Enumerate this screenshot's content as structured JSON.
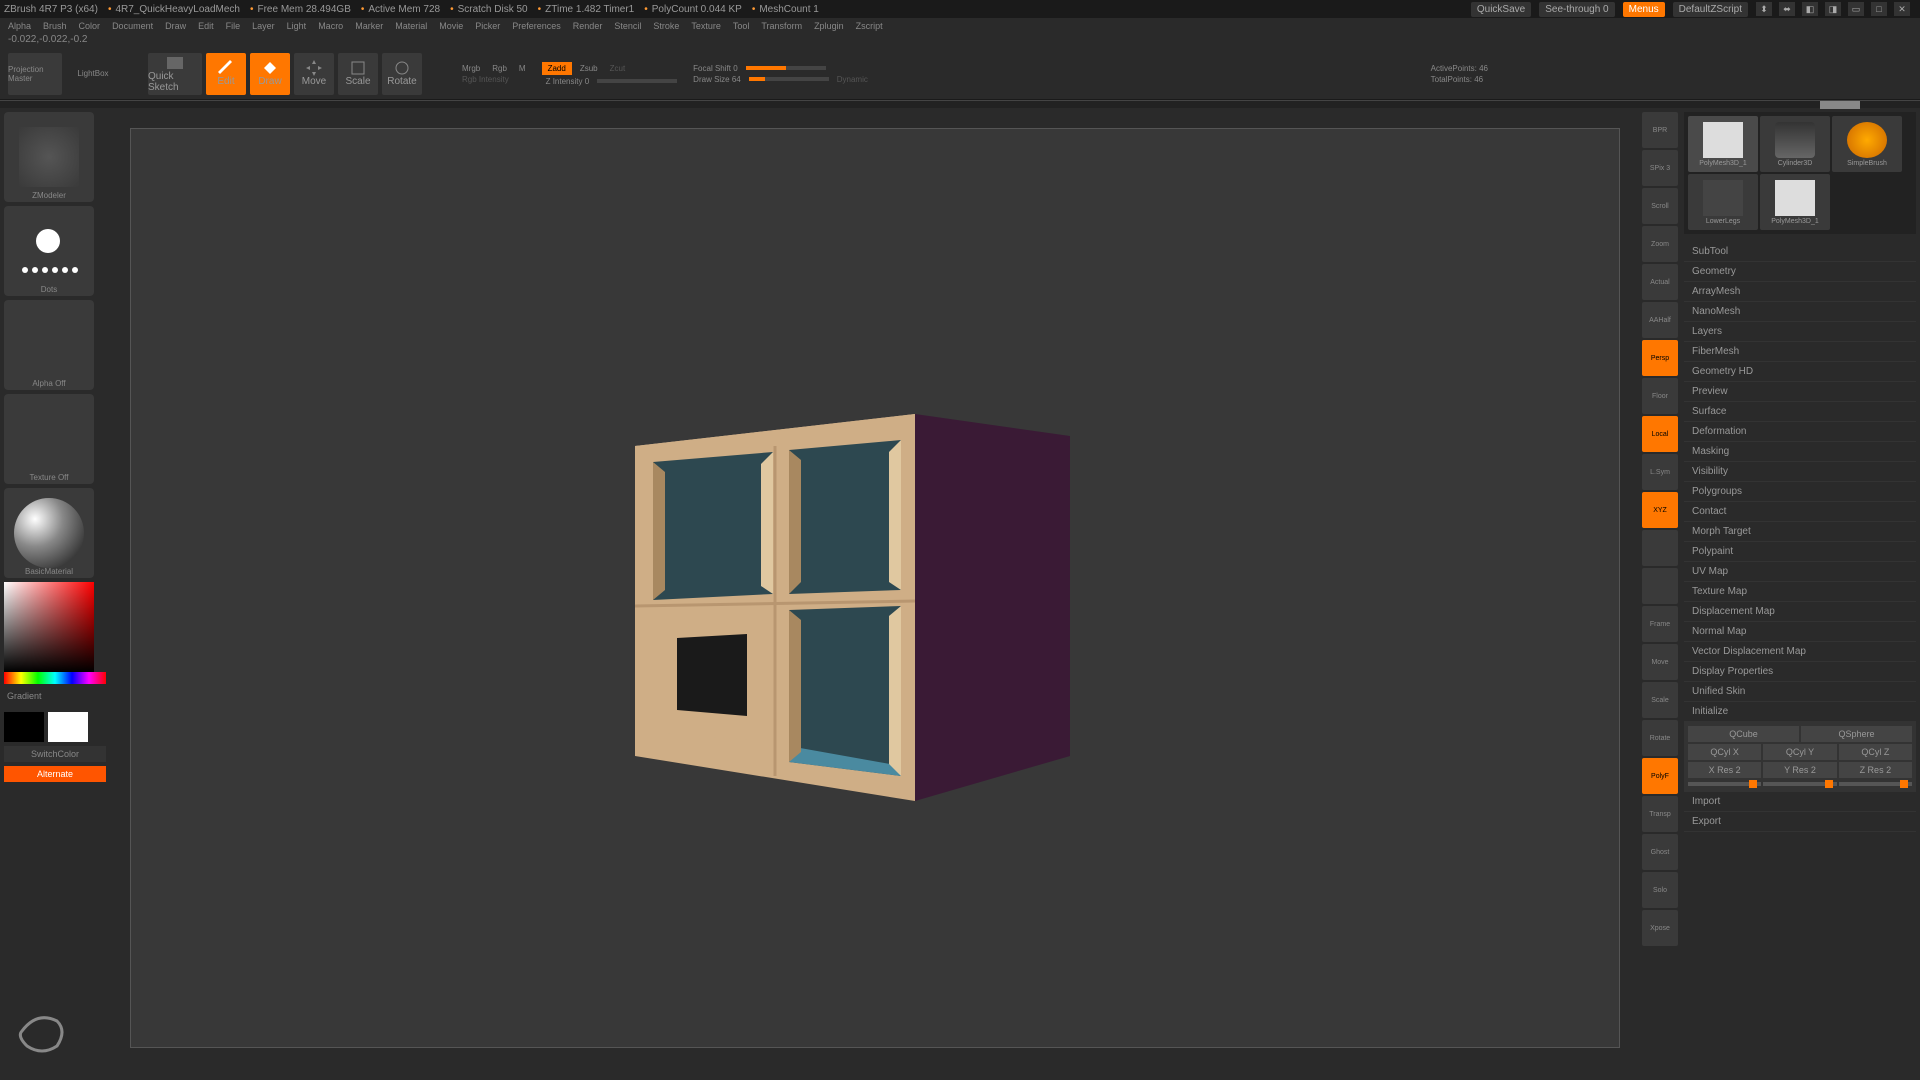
{
  "topbar": {
    "app": "ZBrush 4R7 P3 (x64)",
    "file": "4R7_QuickHeavyLoadMech",
    "stats": [
      "Free Mem 28.494GB",
      "Active Mem 728",
      "Scratch Disk 50",
      "ZTime 1.482 Timer1",
      "PolyCount 0.044 KP",
      "MeshCount 1"
    ],
    "quicksave": "QuickSave",
    "seethrough": "See-through  0",
    "menus": "Menus",
    "script": "DefaultZScript"
  },
  "menubar": [
    "Alpha",
    "Brush",
    "Color",
    "Document",
    "Draw",
    "Edit",
    "File",
    "Layer",
    "Light",
    "Macro",
    "Marker",
    "Material",
    "Movie",
    "Picker",
    "Preferences",
    "Render",
    "Stencil",
    "Stroke",
    "Texture",
    "Tool",
    "Transform",
    "Zplugin",
    "Zscript"
  ],
  "coords": "-0.022,-0.022,-0.2",
  "toolbar": {
    "projection": "Projection Master",
    "lightbox": "LightBox",
    "quicksketch": "Quick Sketch",
    "edit": "Edit",
    "draw": "Draw",
    "move": "Move",
    "scale": "Scale",
    "rotate": "Rotate",
    "mrgb": "Mrgb",
    "rgb": "Rgb",
    "m": "M",
    "rgbintensity": "Rgb Intensity",
    "zadd": "Zadd",
    "zsub": "Zsub",
    "zcut": "Zcut",
    "zintensity": "Z Intensity 0",
    "focalshift": "Focal Shift 0",
    "drawsize": "Draw Size 64",
    "dynamic": "Dynamic",
    "activepoints": "ActivePoints: 46",
    "totalpoints": "TotalPoints: 46"
  },
  "left": {
    "zmodeler": "ZModeler",
    "dots": "Dots",
    "alpha": "Alpha Off",
    "texture": "Texture Off",
    "material": "BasicMaterial",
    "gradient": "Gradient",
    "switchcolor": "SwitchColor",
    "alternate": "Alternate"
  },
  "rightToolbar": [
    "BPR",
    "SPix 3",
    "Scroll",
    "Zoom",
    "Actual",
    "AAHalf",
    "Persp",
    "Floor",
    "Local",
    "L.Sym",
    "XYZ",
    "",
    "",
    "Frame",
    "Move",
    "Scale",
    "Rotate",
    "PolyF",
    "Transp",
    "Ghost",
    "Solo",
    "Xpose"
  ],
  "rightToolbarActive": [
    6,
    8,
    10,
    17
  ],
  "toolThumbs": [
    {
      "label": "PolyMesh3D_1"
    },
    {
      "label": "Cylinder3D"
    },
    {
      "label": "SimpleBrush"
    },
    {
      "label": "LowerLegs"
    },
    {
      "label": "PolyMesh3D_1"
    }
  ],
  "panels": [
    "SubTool",
    "Geometry",
    "ArrayMesh",
    "NanoMesh",
    "Layers",
    "FiberMesh",
    "Geometry HD",
    "Preview",
    "Surface",
    "Deformation",
    "Masking",
    "Visibility",
    "Polygroups",
    "Contact",
    "Morph Target",
    "Polypaint",
    "UV Map",
    "Texture Map",
    "Displacement Map",
    "Normal Map",
    "Vector Displacement Map",
    "Display Properties",
    "Unified Skin",
    "Initialize"
  ],
  "init": {
    "qcube": "QCube",
    "qsphere": "QSphere",
    "qcylx": "QCyl X",
    "qcyly": "QCyl Y",
    "qcylz": "QCyl Z",
    "xres": "X Res 2",
    "yres": "Y Res 2",
    "zres": "Z Res 2",
    "import": "Import",
    "export": "Export"
  }
}
